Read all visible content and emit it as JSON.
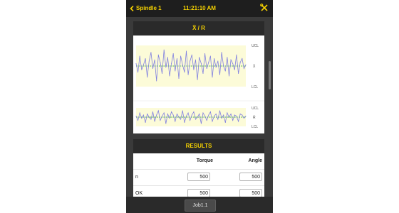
{
  "header": {
    "back_label": "Spindle 1",
    "time": "11:21:10 AM",
    "tools_icon": "tools-icon"
  },
  "chart_card": {
    "title": "X̄ / R",
    "xbar": {
      "ucl_label": "UCL",
      "lcl_label": "LCL",
      "mean_label": "X̄"
    },
    "range": {
      "ucl_label": "UCL",
      "lcl_label": "LCL",
      "mean_label": "R̄"
    }
  },
  "chart_data": [
    {
      "type": "line",
      "title": "X̄",
      "series": [
        {
          "values": [
            0.2,
            -0.5,
            0.8,
            -0.3,
            0.1,
            0.6,
            -0.9,
            0.4,
            1.1,
            -0.2,
            0.5,
            -1.2,
            0.9,
            0.3,
            -0.6,
            1.3,
            -0.1,
            0.7,
            -0.8,
            0.2,
            1.0,
            -0.4,
            0.6,
            -1.0,
            0.8,
            0.1,
            -0.5,
            1.2,
            -0.7,
            0.4,
            0.9,
            -0.3,
            0.5,
            -1.1,
            0.7,
            0.2,
            -0.6,
            1.0,
            -0.2,
            0.3,
            0.8,
            -0.9,
            0.6,
            -0.1,
            0.4,
            -0.7,
            1.1,
            0.0,
            -0.4,
            0.7,
            -0.8,
            0.5,
            0.2,
            -0.3,
            0.9,
            -0.6,
            0.3,
            0.6,
            -0.2,
            0.1
          ]
        }
      ],
      "ylim": [
        -2,
        2
      ]
    },
    {
      "type": "line",
      "title": "R",
      "series": [
        {
          "values": [
            0.1,
            -0.3,
            0.4,
            -0.1,
            0.2,
            -0.5,
            0.3,
            0.0,
            -0.2,
            0.5,
            -0.4,
            0.2,
            0.6,
            -0.3,
            0.1,
            0.4,
            -0.6,
            0.3,
            -0.1,
            0.5,
            0.2,
            -0.4,
            0.3,
            0.0,
            -0.2,
            0.6,
            -0.5,
            0.1,
            0.4,
            -0.3,
            0.2,
            0.5,
            -0.2,
            0.0,
            0.3,
            -0.6,
            0.4,
            0.1,
            -0.3,
            0.2,
            0.5,
            -0.4,
            0.1,
            0.3,
            -0.2,
            0.6,
            -0.1,
            0.2,
            -0.5,
            0.4,
            0.0,
            0.3,
            -0.3,
            0.2,
            0.1,
            -0.4,
            0.3,
            0.2,
            -0.1,
            0.1
          ]
        }
      ],
      "ylim": [
        -1,
        1
      ]
    }
  ],
  "results": {
    "title": "RESULTS",
    "col_torque": "Torque",
    "col_angle": "Angle",
    "rows": [
      {
        "label": "n",
        "torque": "500",
        "angle": "500"
      },
      {
        "label": "OK",
        "torque": "500",
        "angle": "500"
      }
    ]
  },
  "footer": {
    "job_label": "Job1.1"
  },
  "colors": {
    "accent": "#f5d100",
    "bar_bg": "#1e1e1e",
    "xbar_line": "#8080e0",
    "mean_line": "#18a018",
    "limit_band": "#fcfbd8"
  }
}
